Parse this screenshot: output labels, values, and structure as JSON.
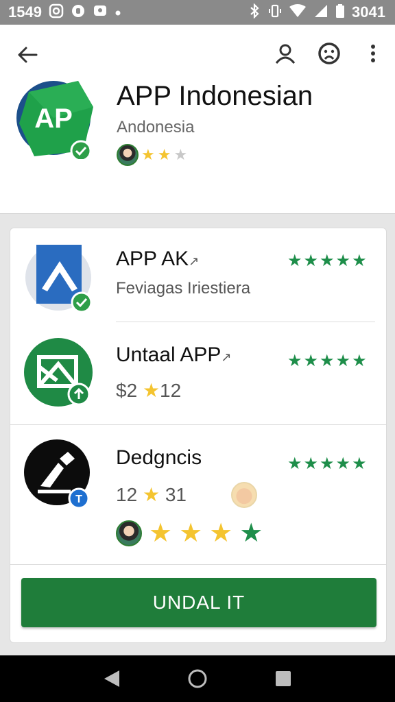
{
  "status_bar": {
    "time": "1549",
    "right_text": "3041",
    "left_icons": [
      "instagram-icon",
      "messenger-icon",
      "chat-icon",
      "notification-dot-icon"
    ],
    "right_icons": [
      "bluetooth-icon",
      "vibrate-icon",
      "wifi-icon",
      "signal-icon",
      "battery-icon"
    ]
  },
  "header": {
    "title": "APP Indonesian",
    "subtitle": "Andonesia",
    "icon_text": "AP",
    "rating_stars": [
      "gold",
      "gold",
      "gray"
    ]
  },
  "apps": [
    {
      "title": "APP AK",
      "title_suffix": "↗",
      "subtitle": "Feviagas Iriestiera",
      "stars": [
        "green",
        "green",
        "green",
        "green",
        "green"
      ]
    },
    {
      "title": "Untaal APP",
      "title_suffix": "↗",
      "price": "$2",
      "rating": "12",
      "stars": [
        "green",
        "green",
        "green",
        "green",
        "green"
      ]
    },
    {
      "title": "Dedgncis",
      "left_count": "12",
      "right_count": "31",
      "stars": [
        "green",
        "green",
        "green",
        "green",
        "green"
      ],
      "big_stars": [
        "gold",
        "gold",
        "gold",
        "green"
      ]
    }
  ],
  "install_button": {
    "label": "UNDAL ІТ"
  },
  "colors": {
    "accent_green": "#1f7d3a",
    "star_gold": "#f4c430",
    "star_green": "#1e8e4a",
    "status_bar": "#8a8a8a"
  }
}
